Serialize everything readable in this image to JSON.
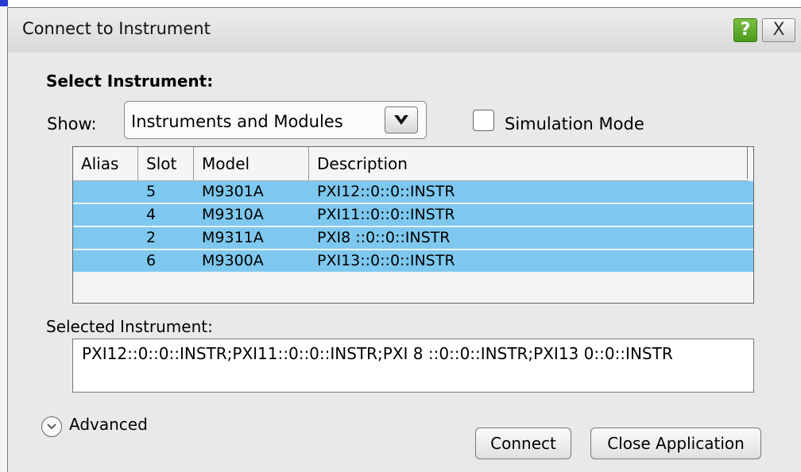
{
  "window": {
    "title": "Connect to Instrument",
    "help_symbol": "?",
    "close_symbol": "X"
  },
  "select_instrument": {
    "heading": "Select Instrument:",
    "show_label": "Show:",
    "show_value": "Instruments and Modules",
    "dropdown_icon": "chevron-down-icon",
    "simulation_label": "Simulation Mode",
    "simulation_checked": false
  },
  "table": {
    "columns": [
      "Alias",
      "Slot",
      "Model",
      "Description"
    ],
    "rows": [
      {
        "alias": "",
        "slot": "5",
        "model": "M9301A",
        "description": "PXI12::0::0::INSTR"
      },
      {
        "alias": "",
        "slot": "4",
        "model": "M9310A",
        "description": "PXI11::0::0::INSTR"
      },
      {
        "alias": "",
        "slot": "2",
        "model": "M9311A",
        "description": "PXI8 ::0::0::INSTR"
      },
      {
        "alias": "",
        "slot": "6",
        "model": "M9300A",
        "description": "PXI13::0::0::INSTR"
      }
    ],
    "selected_row_color": "#7ec8ef"
  },
  "selected_instrument": {
    "label": "Selected Instrument:",
    "value": "PXI12::0::0::INSTR;PXI11::0::0::INSTR;PXI 8 ::0::0::INSTR;PXI13 0::0::INSTR"
  },
  "advanced": {
    "label": "Advanced",
    "icon": "chevron-circle-down-icon"
  },
  "buttons": {
    "connect": "Connect",
    "close_application": "Close Application"
  },
  "colors": {
    "dialog_bg": "#e9e9e9",
    "help_green": "#5aa82a"
  }
}
